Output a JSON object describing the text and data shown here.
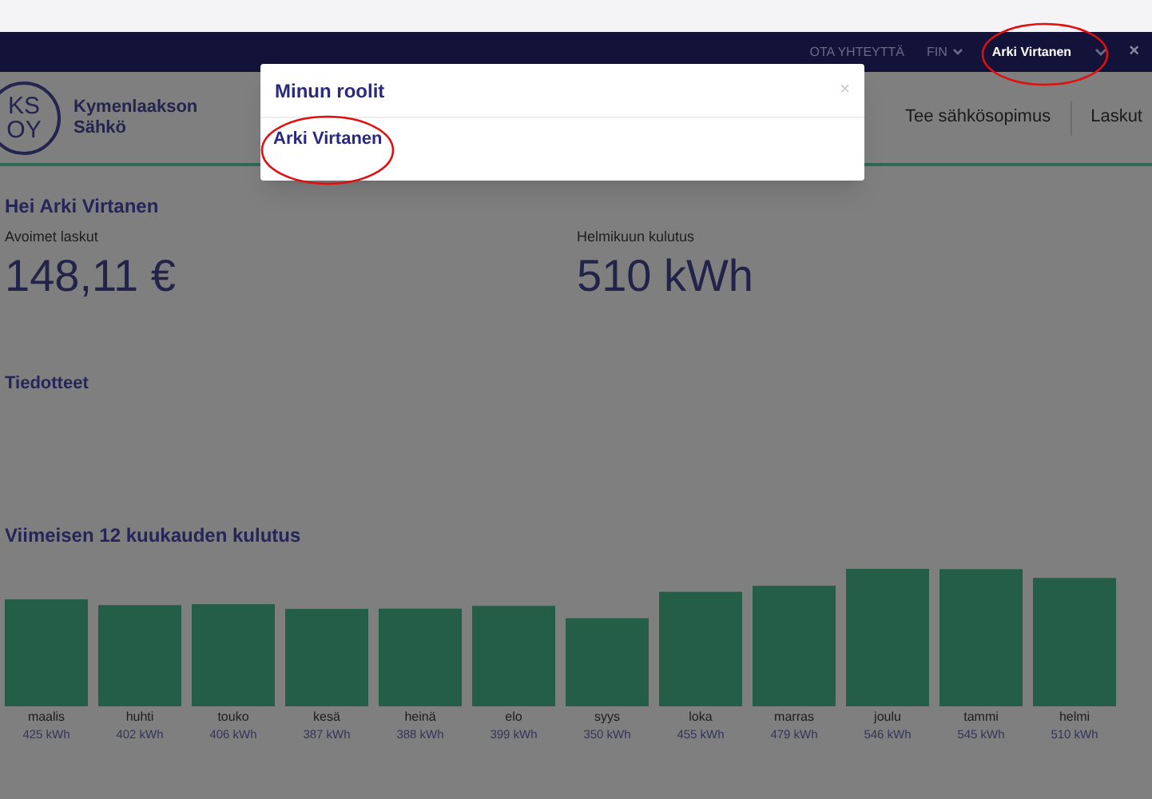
{
  "top_bar": {
    "contact": "OTA YHTEYTTÄ",
    "language": "FIN",
    "user": "Arki Virtanen",
    "close": "×"
  },
  "header": {
    "logo": {
      "top": "KS",
      "bottom": "OY",
      "name": [
        "Kymenlaakson",
        "Sähkö"
      ]
    },
    "nav": [
      "Tee sähkösopimus",
      "Laskut"
    ]
  },
  "greeting": {
    "hello": "Hei",
    "name": "Arki Virtanen"
  },
  "stats": [
    {
      "label": "Avoimet laskut",
      "value": "148,11 €"
    },
    {
      "label": "Helmikuun kulutus",
      "value": "510 kWh"
    }
  ],
  "notices": {
    "title": "Tiedotteet"
  },
  "consumption": {
    "title": "Viimeisen 12 kuukauden kulutus",
    "chart_data": {
      "type": "bar",
      "categories": [
        "maalis",
        "huhti",
        "touko",
        "kesä",
        "heinä",
        "elo",
        "syys",
        "loka",
        "marras",
        "joulu",
        "tammi",
        "helmi"
      ],
      "values": [
        425,
        402,
        406,
        387,
        388,
        399,
        350,
        455,
        479,
        546,
        545,
        510
      ],
      "value_labels": [
        "425 kWh",
        "402 kWh",
        "406 kWh",
        "387 kWh",
        "388 kWh",
        "399 kWh",
        "350 kWh",
        "455 kWh",
        "479 kWh",
        "546 kWh",
        "545 kWh",
        "510 kWh"
      ]
    }
  },
  "modal": {
    "title": "Minun roolit",
    "close": "×",
    "roles": [
      "Arki Virtanen"
    ]
  }
}
